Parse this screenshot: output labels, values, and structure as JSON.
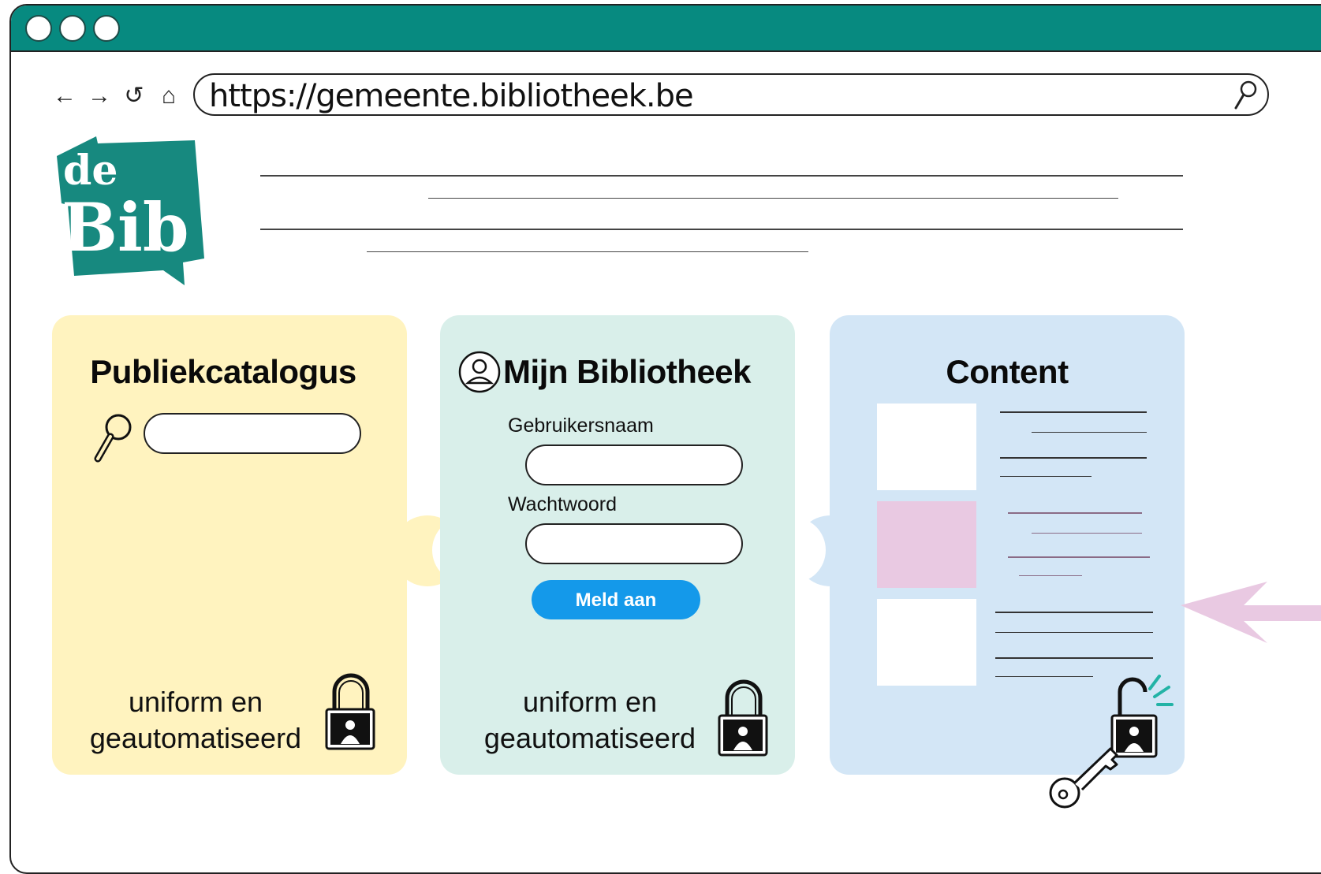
{
  "browser": {
    "url": "https://gemeente.bibliotheek.be",
    "nav_icons": [
      "back-arrow-icon",
      "forward-arrow-icon",
      "reload-icon",
      "home-icon"
    ],
    "accent": "#078a80"
  },
  "logo": {
    "line1": "de",
    "line2": "Bib",
    "color": "#17897f"
  },
  "panels": [
    {
      "title": "Publiekcatalogus",
      "caption_line1": "uniform en",
      "caption_line2": "geautomatiseerd",
      "lock": "locked-padlock-icon",
      "color": "#fff3bf"
    },
    {
      "title": "Mijn Bibliotheek",
      "username_label": "Gebruikersnaam",
      "password_label": "Wachtwoord",
      "login_button": "Meld aan",
      "caption_line1": "uniform en",
      "caption_line2": "geautomatiseerd",
      "lock": "locked-padlock-icon",
      "color": "#d9efea",
      "button_color": "#1499ea"
    },
    {
      "title": "Content",
      "lock": "unlocked-padlock-icon",
      "color": "#d3e6f6",
      "thumb_accent": "#e9c9e2"
    }
  ]
}
